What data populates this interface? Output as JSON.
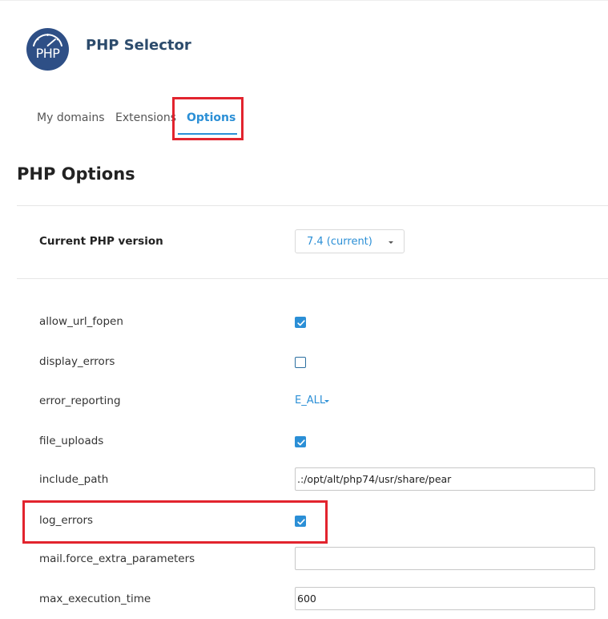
{
  "header": {
    "logo_text": "PHP",
    "title": "PHP Selector"
  },
  "tabs": [
    {
      "label": "My domains",
      "active": false
    },
    {
      "label": "Extensions",
      "active": false
    },
    {
      "label": "Options",
      "active": true
    }
  ],
  "section": {
    "title": "PHP Options"
  },
  "version": {
    "label": "Current PHP version",
    "selected": "7.4 (current)"
  },
  "options": [
    {
      "name": "allow_url_fopen",
      "type": "checkbox",
      "checked": true
    },
    {
      "name": "display_errors",
      "type": "checkbox",
      "checked": false
    },
    {
      "name": "error_reporting",
      "type": "dropdown",
      "value": "E_ALL"
    },
    {
      "name": "file_uploads",
      "type": "checkbox",
      "checked": true
    },
    {
      "name": "include_path",
      "type": "text",
      "value": ".:/opt/alt/php74/usr/share/pear"
    },
    {
      "name": "log_errors",
      "type": "checkbox",
      "checked": true
    },
    {
      "name": "mail.force_extra_parameters",
      "type": "text",
      "value": ""
    },
    {
      "name": "max_execution_time",
      "type": "text",
      "value": "600"
    }
  ],
  "colors": {
    "accent": "#2b8fd6",
    "title": "#2c4b6c",
    "highlight": "#e2242e",
    "logo": "#2e4f86"
  }
}
